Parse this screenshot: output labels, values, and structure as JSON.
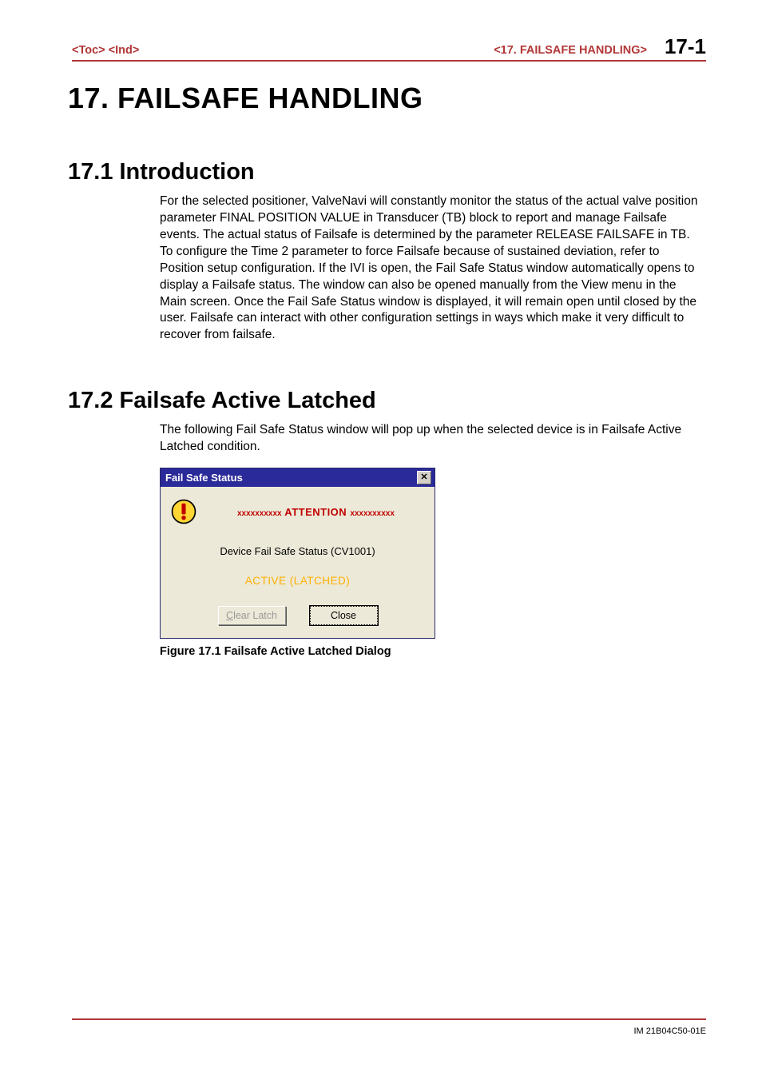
{
  "header": {
    "toc": "<Toc>",
    "ind": "<Ind>",
    "breadcrumb": "<17.  FAILSAFE HANDLING>",
    "page": "17-1"
  },
  "chapter": {
    "title": "17.   FAILSAFE HANDLING"
  },
  "sections": [
    {
      "heading": "17.1  Introduction",
      "body": "For the selected positioner, ValveNavi will constantly monitor the status of the actual valve position parameter FINAL POSITION VALUE in Transducer (TB) block to report and manage Failsafe events.  The actual status of Failsafe is determined by the parameter RELEASE FAILSAFE in TB.  To configure the Time 2 parameter to force Failsafe because of sustained deviation, refer to Position setup configuration.  If the IVI is open, the Fail Safe Status window automatically opens to display a Failsafe status.  The window can also be opened manually from the View menu in the Main screen.  Once the Fail Safe Status window is displayed, it will remain open until closed by the user.  Failsafe can interact with other configuration settings in ways which make it very difficult to recover from failsafe."
    },
    {
      "heading": "17.2  Failsafe Active Latched",
      "body": "The following Fail Safe Status window will pop up when the selected device is in Failsafe Active Latched condition."
    }
  ],
  "dialog": {
    "title": "Fail Safe Status",
    "close_glyph": "✕",
    "attention_stars": "xxxxxxxxxx",
    "attention": "ATTENTION",
    "device_line": "Device Fail Safe Status (CV1001)",
    "status_line": "ACTIVE (LATCHED)",
    "buttons": {
      "clear_pre": "C",
      "clear_rest": "lear Latch",
      "close": "Close"
    }
  },
  "figure_caption": "Figure 17.1 Failsafe Active Latched Dialog",
  "footer": {
    "doc_id": "IM 21B04C50-01E"
  }
}
